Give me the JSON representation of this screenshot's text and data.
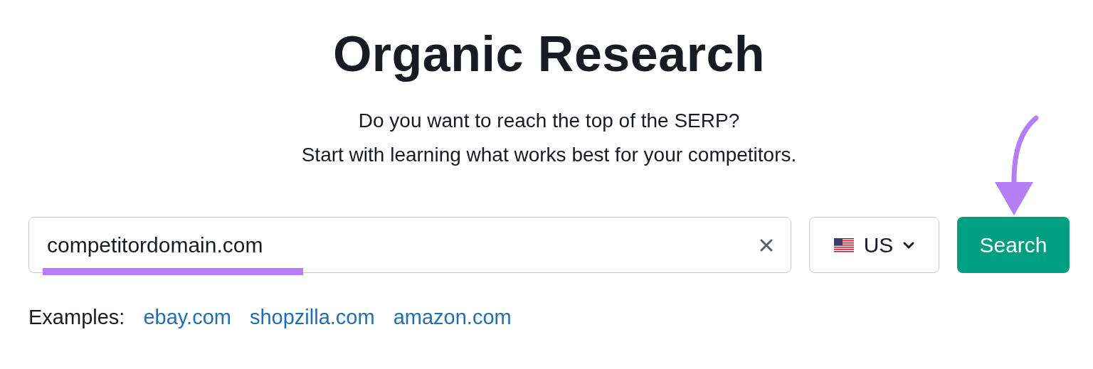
{
  "title": "Organic Research",
  "subtitle": [
    "Do you want to reach the top of the SERP?",
    "Start with learning what works best for your competitors."
  ],
  "search": {
    "value": "competitordomain.com"
  },
  "country": {
    "code": "US"
  },
  "search_button": {
    "label": "Search"
  },
  "examples": {
    "label": "Examples:",
    "links": [
      "ebay.com",
      "shopzilla.com",
      "amazon.com"
    ]
  }
}
